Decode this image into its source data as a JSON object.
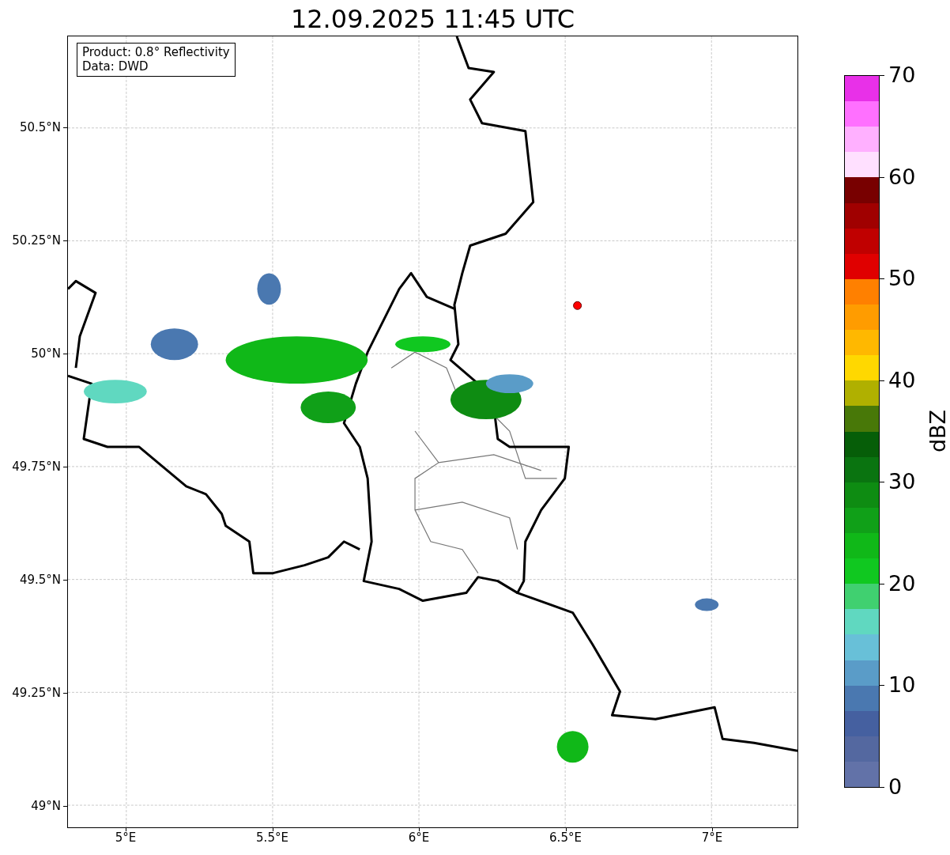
{
  "title": "12.09.2025 11:45 UTC",
  "info_box": [
    "Product: 0.8° Reflectivity",
    "Data: DWD"
  ],
  "y_ticks": [
    "50.5°N",
    "50.25°N",
    "50°N",
    "49.75°N",
    "49.5°N",
    "49.25°N",
    "49°N"
  ],
  "x_ticks": [
    "5°E",
    "5.5°E",
    "6°E",
    "6.5°E",
    "7°E"
  ],
  "colorbar": {
    "label": "dBZ",
    "ticks": [
      "70",
      "60",
      "50",
      "40",
      "30",
      "20",
      "10",
      "0"
    ],
    "segments": [
      {
        "color": "#e830e8"
      },
      {
        "color": "#ff70ff"
      },
      {
        "color": "#ffb0ff"
      },
      {
        "color": "#ffe0ff"
      },
      {
        "color": "#780000"
      },
      {
        "color": "#a00000"
      },
      {
        "color": "#c00000"
      },
      {
        "color": "#e00000"
      },
      {
        "color": "#ff8000"
      },
      {
        "color": "#ff9c00"
      },
      {
        "color": "#ffb800"
      },
      {
        "color": "#ffd800"
      },
      {
        "color": "#b0b000"
      },
      {
        "color": "#487808"
      },
      {
        "color": "#065e08"
      },
      {
        "color": "#0a7410"
      },
      {
        "color": "#0e8c12"
      },
      {
        "color": "#10a018"
      },
      {
        "color": "#10b818"
      },
      {
        "color": "#10c820"
      },
      {
        "color": "#40d070"
      },
      {
        "color": "#60d8c0"
      },
      {
        "color": "#68c0d8"
      },
      {
        "color": "#5a9cc8"
      },
      {
        "color": "#4a78b0"
      },
      {
        "color": "#4560a0"
      },
      {
        "color": "#5468a0"
      },
      {
        "color": "#6272a8"
      }
    ]
  }
}
